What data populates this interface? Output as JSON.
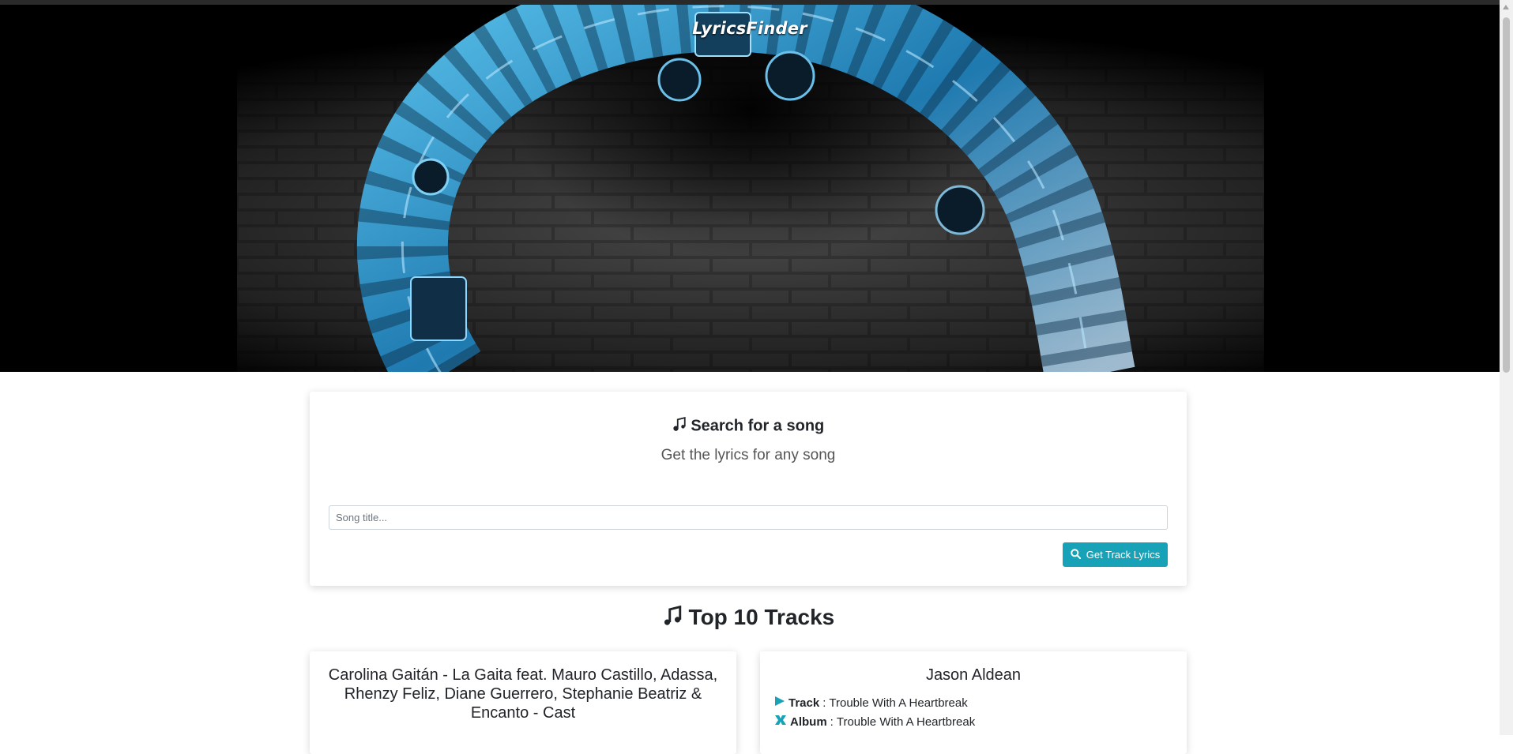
{
  "app": {
    "brand": "LyricsFinder"
  },
  "search": {
    "title": "Search for a song",
    "subtitle": "Get the lyrics for any song",
    "placeholder": "Song title...",
    "button_label": "Get Track Lyrics"
  },
  "top_tracks": {
    "heading": "Top 10 Tracks",
    "items": [
      {
        "title": "Carolina Gaitán - La Gaita feat. Mauro Castillo, Adassa, Rhenzy Feliz, Diane Guerrero, Stephanie Beatriz & Encanto - Cast"
      },
      {
        "title": "Jason Aldean",
        "track_label": "Track",
        "track_value": "Trouble With A Heartbreak",
        "album_label": "Album",
        "album_value": "Trouble With A Heartbreak"
      }
    ]
  },
  "colors": {
    "accent": "#17a2b8",
    "hero_glow": "#2aa7e0"
  },
  "icons": {
    "music": "music-icon",
    "search": "search-icon",
    "play": "play-icon",
    "album": "album-icon"
  }
}
